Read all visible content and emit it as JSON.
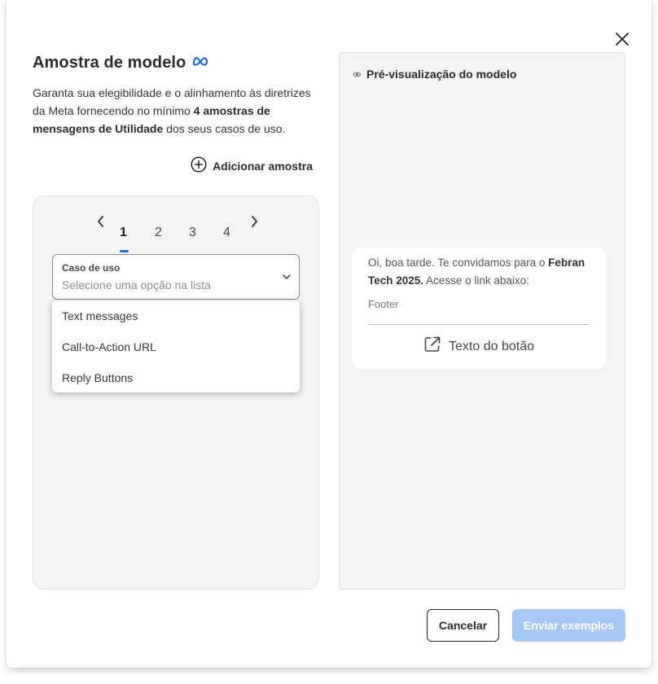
{
  "modal": {
    "title": "Amostra de modelo",
    "description_part1": "Garanta sua elegibilidade e o alinhamento às diretrizes da Meta fornecendo no mínimo ",
    "description_bold1": "4 amostras de mensagens de Utilidade",
    "description_part2": " dos seus casos de uso.",
    "add_sample_label": "Adicionar amostra",
    "cancel_label": "Cancelar",
    "submit_label": "Enviar exemplos"
  },
  "pager": {
    "pages": [
      "1",
      "2",
      "3",
      "4"
    ],
    "active": "1"
  },
  "use_case": {
    "label": "Caso de uso",
    "placeholder": "Selecione uma opção na lista",
    "options": [
      "Text messages",
      "Call-to-Action URL",
      "Reply Buttons"
    ]
  },
  "preview": {
    "header": "Pré-visualização do modelo",
    "message_part1": "Oi, boa tarde. Te convidamos para o ",
    "message_bold": "Febran Tech 2025.",
    "message_part2": " Acesse o link abaixo:",
    "footer": "Footer",
    "button_label": "Texto do botão"
  },
  "colors": {
    "accent": "#1f6fd6",
    "meta_logo": "#0a66e8",
    "submit_disabled": "#a7c7f4"
  },
  "icons": [
    "close-icon",
    "meta-logo-icon",
    "add-circle-icon",
    "chevron-left-icon",
    "chevron-right-icon",
    "chevron-down-icon",
    "eye-icon",
    "external-link-icon"
  ]
}
